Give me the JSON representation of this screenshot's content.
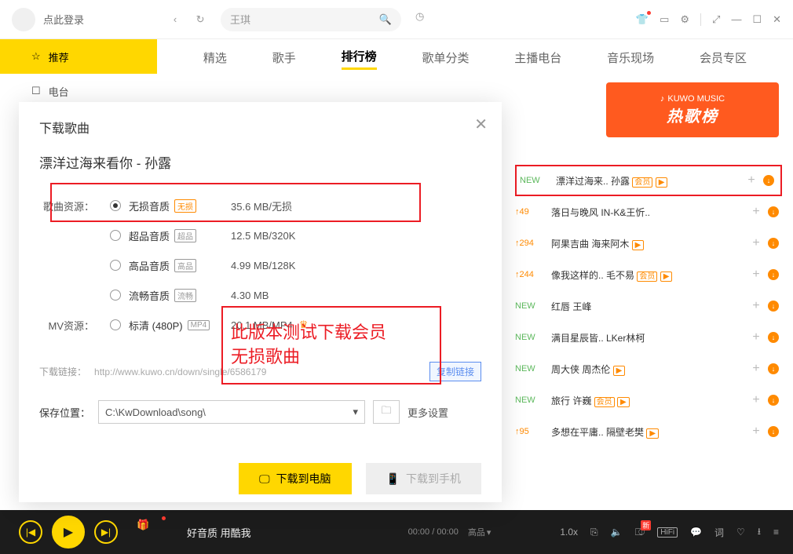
{
  "header": {
    "login_text": "点此登录",
    "search_placeholder": "王琪"
  },
  "sidebar": {
    "items": [
      {
        "label": "推荐"
      },
      {
        "label": "电台"
      }
    ]
  },
  "tabs": [
    "精选",
    "歌手",
    "排行榜",
    "歌单分类",
    "主播电台",
    "音乐现场",
    "会员专区"
  ],
  "banner": {
    "logo": "KUWO MUSIC",
    "title": "热歌榜"
  },
  "songs": [
    {
      "rank_type": "new",
      "rank": "NEW",
      "name": "漂洋过海来.. 孙露",
      "vip": true,
      "play": true,
      "hl": true
    },
    {
      "rank_type": "up",
      "rank": "↑49",
      "name": "落日与晚风 IN-K&王忻..",
      "vip": false,
      "play": false
    },
    {
      "rank_type": "up",
      "rank": "↑294",
      "name": "阿果吉曲 海来阿木",
      "vip": false,
      "play": true
    },
    {
      "rank_type": "up",
      "rank": "↑244",
      "name": "像我这样的.. 毛不易",
      "vip": true,
      "play": true
    },
    {
      "rank_type": "new",
      "rank": "NEW",
      "name": "红唇 王峰",
      "vip": false,
      "play": false
    },
    {
      "rank_type": "new",
      "rank": "NEW",
      "name": "满目星辰皆.. LKer林柯",
      "vip": false,
      "play": false
    },
    {
      "rank_type": "new",
      "rank": "NEW",
      "name": "周大侠 周杰伦",
      "vip": false,
      "play": true
    },
    {
      "rank_type": "new",
      "rank": "NEW",
      "name": "旅行 许巍",
      "vip": true,
      "play": true
    },
    {
      "rank_type": "up",
      "rank": "↑95",
      "name": "多想在平庸.. 隔壁老樊",
      "vip": false,
      "play": true
    }
  ],
  "modal": {
    "title": "下载歌曲",
    "song": "漂洋过海来看你 - 孙露",
    "source_label": "歌曲资源：",
    "mv_label": "MV资源：",
    "qualities": [
      {
        "name": "无损音质",
        "tag": "无损",
        "tag_color": "orange",
        "size": "35.6 MB/无损",
        "selected": true
      },
      {
        "name": "超品音质",
        "tag": "超品",
        "tag_color": "gray",
        "size": "12.5 MB/320K",
        "selected": false
      },
      {
        "name": "高品音质",
        "tag": "高品",
        "tag_color": "gray",
        "size": "4.99 MB/128K",
        "selected": false
      },
      {
        "name": "流畅音质",
        "tag": "流畅",
        "tag_color": "gray",
        "size": "4.30 MB",
        "selected": false
      }
    ],
    "mv": {
      "name": "标清 (480P)",
      "tag": "MP4",
      "size": "20.1 MB/MP4",
      "crown": true
    },
    "annotation": [
      "此版本测试下载会员",
      "无损歌曲"
    ],
    "link_label": "下载链接：",
    "link_value": "http://www.kuwo.cn/down/single/6586179",
    "copy_btn": "复制链接",
    "save_label": "保存位置：",
    "save_value": "C:\\KwDownload\\song\\",
    "more_settings": "更多设置",
    "download_pc": "下载到电脑",
    "download_phone": "下载到手机"
  },
  "player": {
    "title": "好音质 用酷我",
    "time": "00:00 / 00:00",
    "quality": "高品",
    "speed": "1.0x",
    "hifi": "HiFi",
    "word": "词",
    "new": "新"
  }
}
